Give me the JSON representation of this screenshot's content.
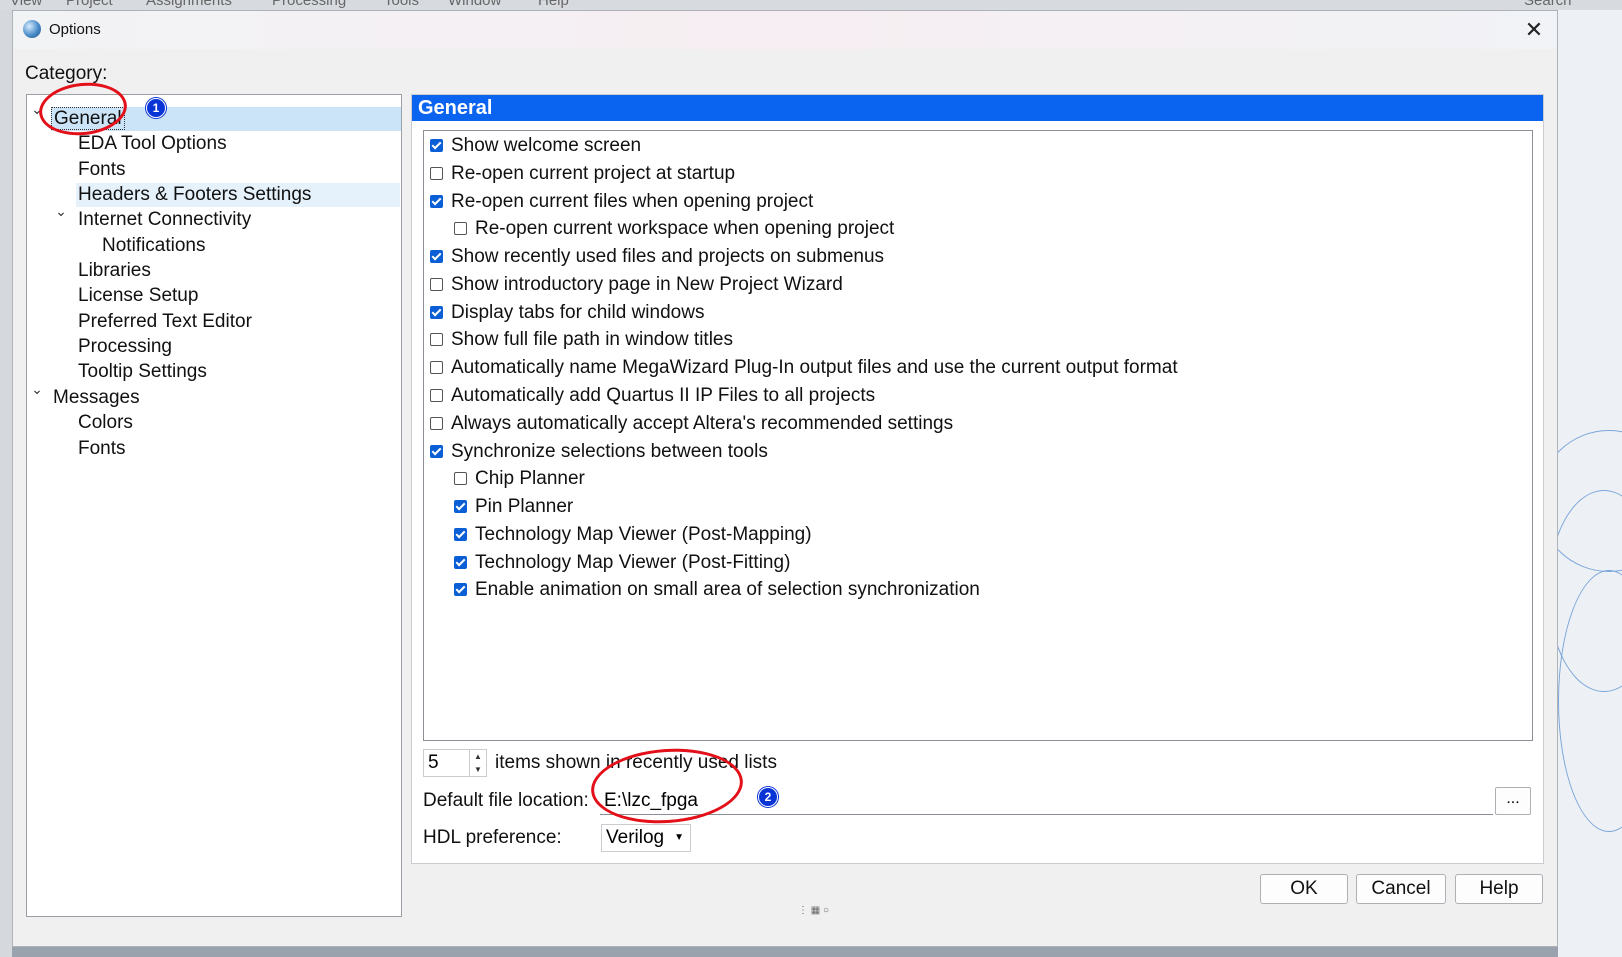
{
  "background": {
    "menubar_partial": [
      "View",
      "Project",
      "Assignments",
      "Processing",
      "Tools",
      "Window",
      "Help"
    ],
    "search_partial": "Search"
  },
  "dialog": {
    "title": "Options",
    "close_glyph": "✕",
    "category_label": "Category:"
  },
  "tree": {
    "items": [
      {
        "label": "General",
        "expanded": true,
        "selected": true
      },
      {
        "label": "EDA Tool Options"
      },
      {
        "label": "Fonts"
      },
      {
        "label": "Headers & Footers Settings",
        "highlighted": true
      },
      {
        "label": "Internet Connectivity",
        "expanded": true
      },
      {
        "label": "Notifications"
      },
      {
        "label": "Libraries"
      },
      {
        "label": "License Setup"
      },
      {
        "label": "Preferred Text Editor"
      },
      {
        "label": "Processing"
      },
      {
        "label": "Tooltip Settings"
      },
      {
        "label": "Messages",
        "expanded": true
      },
      {
        "label": "Colors"
      },
      {
        "label": "Fonts"
      }
    ],
    "chevron": "⌄"
  },
  "panel": {
    "header": "General",
    "options": [
      {
        "label": "Show welcome screen",
        "checked": true
      },
      {
        "label": "Re-open current project at startup",
        "checked": false
      },
      {
        "label": "Re-open current files when opening project",
        "checked": true
      },
      {
        "label": "Re-open current workspace when opening project",
        "checked": false
      },
      {
        "label": "Show recently used files and projects on submenus",
        "checked": true
      },
      {
        "label": "Show introductory page in New Project Wizard",
        "checked": false
      },
      {
        "label": "Display tabs for child windows",
        "checked": true
      },
      {
        "label": "Show full file path in window titles",
        "checked": false
      },
      {
        "label": "Automatically name MegaWizard Plug-In output files and use the current output format",
        "checked": false
      },
      {
        "label": "Automatically add Quartus II IP Files to all projects",
        "checked": false
      },
      {
        "label": "Always automatically accept Altera's recommended settings",
        "checked": false
      },
      {
        "label": "Synchronize selections between tools",
        "checked": true
      },
      {
        "label": "Chip Planner",
        "checked": false
      },
      {
        "label": "Pin Planner",
        "checked": true
      },
      {
        "label": "Technology Map Viewer (Post-Mapping)",
        "checked": true
      },
      {
        "label": "Technology Map Viewer (Post-Fitting)",
        "checked": true
      },
      {
        "label": "Enable animation on small area of selection synchronization",
        "checked": true
      }
    ],
    "recent_count": "5",
    "recent_label": "items shown in recently used lists",
    "file_location_label": "Default file location:",
    "file_location_value": "E:\\lzc_fpga",
    "browse_label": "...",
    "hdl_label": "HDL preference:",
    "hdl_value": "Verilog"
  },
  "buttons": {
    "ok": "OK",
    "cancel": "Cancel",
    "help": "Help"
  },
  "annotations": {
    "badge1": "1",
    "badge2": "2",
    "annotation_color": "#e3101a",
    "badge_color": "#0a35d6"
  },
  "colors": {
    "header_blue": "#0a64f0",
    "checkbox_blue": "#0a5fd6",
    "selection": "#cce4f7"
  }
}
